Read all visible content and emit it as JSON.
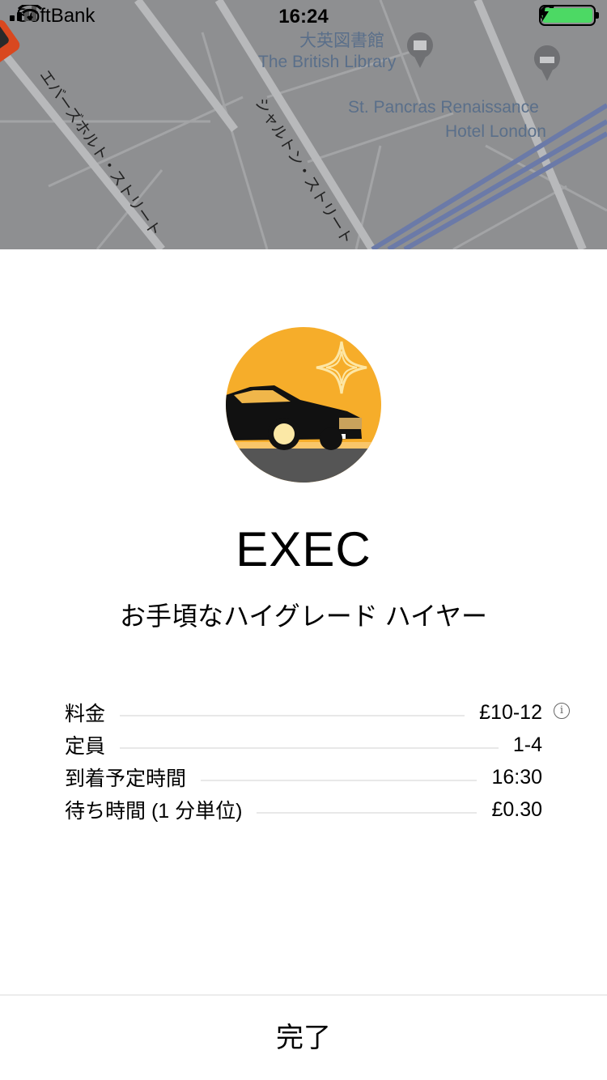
{
  "status_bar": {
    "carrier": "SoftBank",
    "time": "16:24"
  },
  "map": {
    "poi_library_ja": "大英図書館",
    "poi_library_en": "The British Library",
    "poi_hotel_line1": "St. Pancras Renaissance",
    "poi_hotel_line2": "Hotel London",
    "street_1": "エバーズホルト・ストリート",
    "street_2": "シャルトン・ストリート"
  },
  "product": {
    "name": "EXEC",
    "description": "お手頃なハイグレード ハイヤー"
  },
  "details": [
    {
      "label": "料金",
      "value": "£10-12"
    },
    {
      "label": "定員",
      "value": "1-4"
    },
    {
      "label": "到着予定時間",
      "value": "16:30"
    },
    {
      "label": "待ち時間 (1 分単位)",
      "value": "£0.30"
    }
  ],
  "info_icon_glyph": "i",
  "done_button": "完了",
  "colors": {
    "hero_yellow": "#f6ad2a",
    "map_bg": "#8e8f91",
    "route_blue": "#6b7aa8"
  }
}
